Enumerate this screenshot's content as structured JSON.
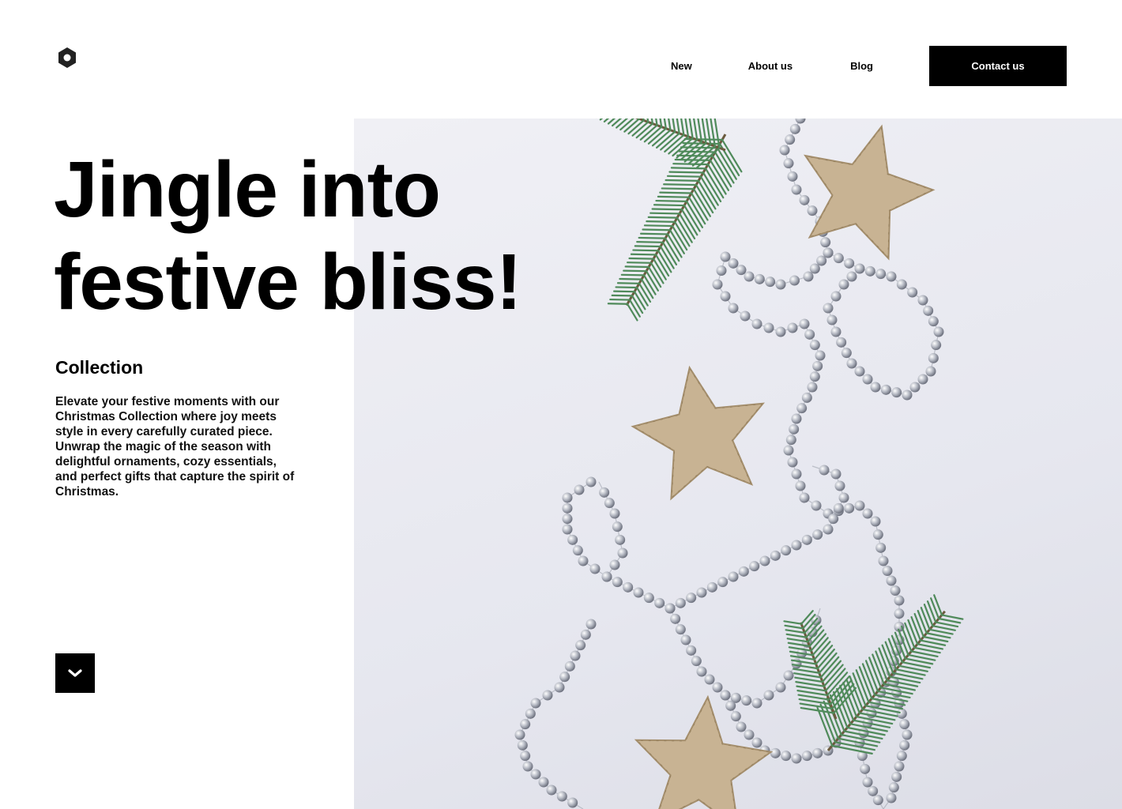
{
  "nav": {
    "items": [
      {
        "label": "New"
      },
      {
        "label": "About us"
      },
      {
        "label": "Blog"
      }
    ],
    "contact_label": "Contact us"
  },
  "hero": {
    "title_line1": "Jingle into",
    "title_line2": "festive bliss!",
    "subtitle": "Collection",
    "description": "Elevate your festive moments with our Christmas Collection where joy meets style in every carefully curated piece. Unwrap the magic of the season with delightful ornaments, cozy essentials, and perfect gifts that capture the spirit of Christmas."
  },
  "icons": {
    "logo": "hexagon-logo-icon",
    "scroll": "chevron-down-icon"
  },
  "colors": {
    "accent": "#000000",
    "background": "#ffffff",
    "image_bg": "#e8e9f0",
    "pine": "#4f8a5a",
    "birch": "#c8b393",
    "bead": "#b4b8c2"
  }
}
